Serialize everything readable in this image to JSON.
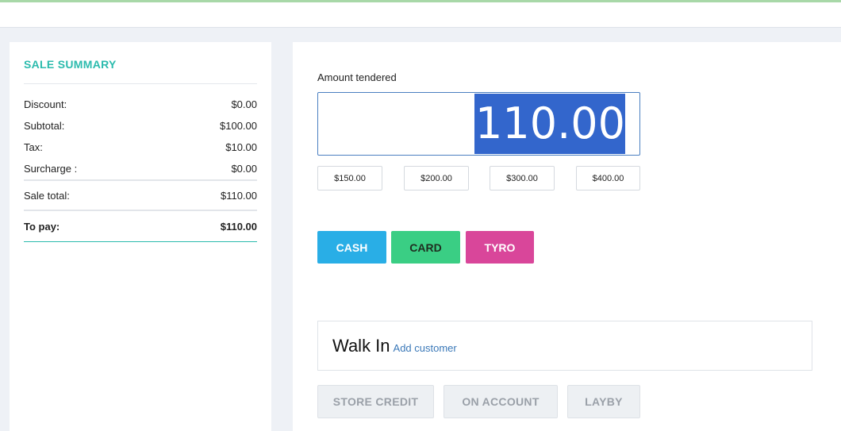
{
  "summary": {
    "title": "SALE SUMMARY",
    "rows": [
      {
        "label": "Discount:",
        "value": "$0.00"
      },
      {
        "label": "Subtotal:",
        "value": "$100.00"
      },
      {
        "label": "Tax:",
        "value": "$10.00"
      },
      {
        "label": "Surcharge :",
        "value": "$0.00"
      }
    ],
    "sale_total": {
      "label": "Sale total:",
      "value": "$110.00"
    },
    "to_pay": {
      "label": "To pay:",
      "value": "$110.00"
    },
    "accent_color": "#2bbbad"
  },
  "payment": {
    "amount_label": "Amount tendered",
    "amount_value": "110.00",
    "quick_amounts": [
      "$150.00",
      "$200.00",
      "$300.00",
      "$400.00"
    ],
    "methods": [
      {
        "label": "CASH",
        "color": "#29aee6"
      },
      {
        "label": "CARD",
        "color": "#3ace84"
      },
      {
        "label": "TYRO",
        "color": "#d9469a"
      }
    ]
  },
  "customer": {
    "name": "Walk In",
    "add_link": "Add customer"
  },
  "alt_methods": [
    "STORE CREDIT",
    "ON ACCOUNT",
    "LAYBY"
  ]
}
